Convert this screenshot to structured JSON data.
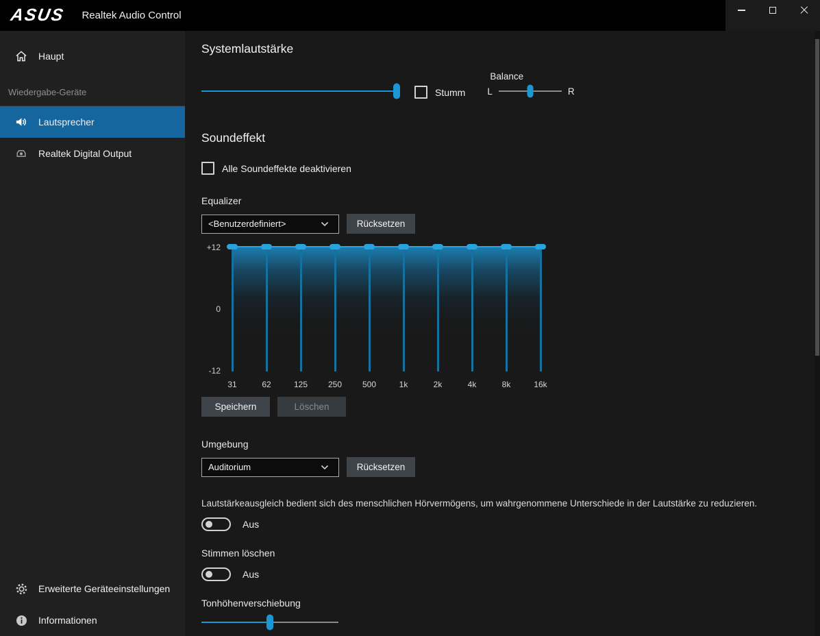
{
  "accent_color": "#1d97d4",
  "titlebar": {
    "brand": "ASUS",
    "title": "Realtek Audio Control"
  },
  "sidebar": {
    "items": {
      "home": "Haupt",
      "playback_section": "Wiedergabe-Geräte",
      "speakers": "Lautsprecher",
      "digital_output": "Realtek Digital Output",
      "advanced_settings": "Erweiterte Geräteeinstellungen",
      "information": "Informationen"
    },
    "active_item": "Lautsprecher"
  },
  "system_volume": {
    "heading": "Systemlautstärke",
    "volume_percent": 100,
    "mute_label": "Stumm",
    "mute_checked": false,
    "balance": {
      "label": "Balance",
      "left": "L",
      "right": "R",
      "percent": 50
    }
  },
  "sound_effect": {
    "heading": "Soundeffekt",
    "disable_all": {
      "label": "Alle Soundeffekte deaktivieren",
      "checked": false
    },
    "equalizer": {
      "label": "Equalizer",
      "preset": "<Benutzerdefiniert>",
      "reset_button": "Rücksetzen",
      "save_button": "Speichern",
      "delete_button": "Löschen",
      "delete_enabled": false,
      "axis": {
        "max": "+12",
        "mid": "0",
        "min": "-12"
      },
      "bands": [
        {
          "freq": "31",
          "value": 12
        },
        {
          "freq": "62",
          "value": 12
        },
        {
          "freq": "125",
          "value": 12
        },
        {
          "freq": "250",
          "value": 12
        },
        {
          "freq": "500",
          "value": 12
        },
        {
          "freq": "1k",
          "value": 12
        },
        {
          "freq": "2k",
          "value": 12
        },
        {
          "freq": "4k",
          "value": 12
        },
        {
          "freq": "8k",
          "value": 12
        },
        {
          "freq": "16k",
          "value": 12
        }
      ]
    },
    "environment": {
      "label": "Umgebung",
      "preset": "Auditorium",
      "reset_button": "Rücksetzen"
    },
    "loudness": {
      "description": "Lautstärkeausgleich bedient sich des menschlichen Hörvermögens, um wahrgenommene Unterschiede in der Lautstärke zu reduzieren.",
      "state": "Aus",
      "enabled": false
    },
    "voice_cancellation": {
      "label": "Stimmen löschen",
      "state": "Aus",
      "enabled": false
    },
    "pitch_shift": {
      "label": "Tonhöhenverschiebung",
      "percent": 50
    }
  }
}
